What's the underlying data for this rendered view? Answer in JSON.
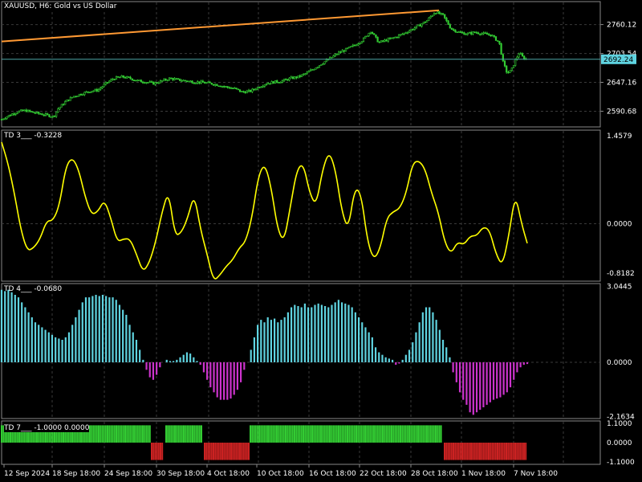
{
  "window": {
    "symbol": "XAUUSD",
    "timeframe": "H6",
    "description": "Gold vs US Dollar",
    "title_text": "XAUUSD, H6:  Gold vs US Dollar"
  },
  "colors": {
    "background": "#000000",
    "grid": "#3a3a3a",
    "candle": "#33cc33",
    "trendline": "#ff9933",
    "price_line": "#4da6a6",
    "price_tag": "#5fd3e0",
    "td3_line": "#ffff00",
    "td4_pos": "#5fd3e0",
    "td4_neg": "#cc33cc",
    "td7_pos": "#33cc33",
    "td7_neg": "#cc2222"
  },
  "time_axis": [
    "12 Sep 2024",
    "18 Sep 18:00",
    "24 Sep 18:00",
    "30 Sep 18:00",
    "4 Oct 18:00",
    "10 Oct 18:00",
    "16 Oct 18:00",
    "22 Oct 18:00",
    "28 Oct 18:00",
    "1 Nov 18:00",
    "7 Nov 18:00"
  ],
  "panes": {
    "price": {
      "axis_labels": [
        "2760.12",
        "2703.54",
        "2647.16",
        "2590.68"
      ],
      "current_price": "2692.24"
    },
    "td3": {
      "label": "TD 3___",
      "value": "-0.3228",
      "axis_labels": [
        "1.4579",
        "0.0000",
        "-0.8182"
      ]
    },
    "td4": {
      "label": "TD 4___",
      "value": "-0.0680",
      "axis_labels": [
        "3.0445",
        "0.0000",
        "-2.1634"
      ]
    },
    "td7": {
      "label": "TD 7___",
      "value": "-1.0000 0.0000",
      "axis_labels": [
        "1.1000",
        "0.0000",
        "-1.1000"
      ]
    }
  },
  "chart_data": [
    {
      "type": "candlestick",
      "title": "XAUUSD, H6:  Gold vs US Dollar",
      "x": [
        "12 Sep 2024",
        "18 Sep 18:00",
        "24 Sep 18:00",
        "30 Sep 18:00",
        "4 Oct 18:00",
        "10 Oct 18:00",
        "16 Oct 18:00",
        "22 Oct 18:00",
        "28 Oct 18:00",
        "1 Nov 18:00",
        "7 Nov 18:00"
      ],
      "close_path": [
        [
          0,
          2575
        ],
        [
          10,
          2583
        ],
        [
          20,
          2590
        ],
        [
          30,
          2592
        ],
        [
          40,
          2588
        ],
        [
          50,
          2585
        ],
        [
          60,
          2582
        ],
        [
          65,
          2580
        ],
        [
          70,
          2595
        ],
        [
          80,
          2610
        ],
        [
          90,
          2620
        ],
        [
          100,
          2625
        ],
        [
          110,
          2630
        ],
        [
          120,
          2632
        ],
        [
          130,
          2645
        ],
        [
          140,
          2655
        ],
        [
          150,
          2658
        ],
        [
          160,
          2655
        ],
        [
          170,
          2650
        ],
        [
          180,
          2648
        ],
        [
          190,
          2645
        ],
        [
          200,
          2650
        ],
        [
          210,
          2655
        ],
        [
          220,
          2652
        ],
        [
          230,
          2650
        ],
        [
          240,
          2648
        ],
        [
          250,
          2647
        ],
        [
          260,
          2645
        ],
        [
          270,
          2642
        ],
        [
          280,
          2638
        ],
        [
          290,
          2635
        ],
        [
          300,
          2628
        ],
        [
          310,
          2630
        ],
        [
          320,
          2638
        ],
        [
          330,
          2645
        ],
        [
          340,
          2648
        ],
        [
          350,
          2650
        ],
        [
          360,
          2655
        ],
        [
          370,
          2658
        ],
        [
          380,
          2665
        ],
        [
          390,
          2675
        ],
        [
          400,
          2685
        ],
        [
          410,
          2695
        ],
        [
          420,
          2705
        ],
        [
          430,
          2712
        ],
        [
          440,
          2720
        ],
        [
          450,
          2730
        ],
        [
          460,
          2748
        ],
        [
          470,
          2725
        ],
        [
          480,
          2730
        ],
        [
          490,
          2735
        ],
        [
          500,
          2742
        ],
        [
          510,
          2750
        ],
        [
          520,
          2758
        ],
        [
          530,
          2768
        ],
        [
          540,
          2785
        ],
        [
          550,
          2778
        ],
        [
          560,
          2752
        ],
        [
          570,
          2745
        ],
        [
          580,
          2742
        ],
        [
          590,
          2745
        ],
        [
          600,
          2742
        ],
        [
          610,
          2740
        ],
        [
          620,
          2725
        ],
        [
          625,
          2685
        ],
        [
          630,
          2665
        ],
        [
          635,
          2670
        ],
        [
          640,
          2690
        ],
        [
          645,
          2705
        ],
        [
          650,
          2695
        ],
        [
          655,
          2692
        ]
      ],
      "trendline": [
        [
          0,
          2727
        ],
        [
          545,
          2788
        ]
      ],
      "y_ticks": [
        2760.12,
        2703.54,
        2647.16,
        2590.68
      ],
      "current_price": 2692.24
    },
    {
      "type": "line",
      "title": "TD 3___ -0.3228",
      "series": [
        {
          "values_path": [
            [
              0,
              1.35
            ],
            [
              8,
              1.0
            ],
            [
              16,
              0.5
            ],
            [
              24,
              -0.1
            ],
            [
              32,
              -0.45
            ],
            [
              40,
              -0.4
            ],
            [
              48,
              -0.25
            ],
            [
              56,
              0.05
            ],
            [
              64,
              0.05
            ],
            [
              72,
              0.3
            ],
            [
              80,
              0.95
            ],
            [
              88,
              1.1
            ],
            [
              96,
              0.9
            ],
            [
              104,
              0.45
            ],
            [
              112,
              0.15
            ],
            [
              120,
              0.2
            ],
            [
              128,
              0.4
            ],
            [
              136,
              0.1
            ],
            [
              144,
              -0.3
            ],
            [
              152,
              -0.25
            ],
            [
              160,
              -0.25
            ],
            [
              168,
              -0.5
            ],
            [
              176,
              -0.8
            ],
            [
              184,
              -0.65
            ],
            [
              192,
              -0.3
            ],
            [
              200,
              0.2
            ],
            [
              208,
              0.55
            ],
            [
              216,
              -0.2
            ],
            [
              224,
              -0.15
            ],
            [
              232,
              0.1
            ],
            [
              240,
              0.5
            ],
            [
              248,
              -0.1
            ],
            [
              256,
              -0.5
            ],
            [
              264,
              -0.95
            ],
            [
              272,
              -0.85
            ],
            [
              280,
              -0.7
            ],
            [
              288,
              -0.6
            ],
            [
              296,
              -0.4
            ],
            [
              304,
              -0.3
            ],
            [
              312,
              0.1
            ],
            [
              320,
              0.8
            ],
            [
              328,
              1.0
            ],
            [
              336,
              0.6
            ],
            [
              344,
              -0.1
            ],
            [
              352,
              -0.3
            ],
            [
              360,
              0.3
            ],
            [
              368,
              0.9
            ],
            [
              376,
              1.0
            ],
            [
              384,
              0.5
            ],
            [
              392,
              0.3
            ],
            [
              400,
              0.9
            ],
            [
              408,
              1.2
            ],
            [
              416,
              0.9
            ],
            [
              424,
              0.2
            ],
            [
              432,
              -0.1
            ],
            [
              440,
              0.6
            ],
            [
              448,
              0.5
            ],
            [
              456,
              -0.3
            ],
            [
              464,
              -0.6
            ],
            [
              472,
              -0.4
            ],
            [
              480,
              0.1
            ],
            [
              488,
              0.2
            ],
            [
              496,
              0.25
            ],
            [
              504,
              0.5
            ],
            [
              512,
              1.0
            ],
            [
              520,
              1.05
            ],
            [
              528,
              0.9
            ],
            [
              536,
              0.5
            ],
            [
              544,
              0.2
            ],
            [
              552,
              -0.3
            ],
            [
              560,
              -0.5
            ],
            [
              568,
              -0.3
            ],
            [
              576,
              -0.35
            ],
            [
              584,
              -0.2
            ],
            [
              592,
              -0.2
            ],
            [
              600,
              -0.05
            ],
            [
              608,
              -0.1
            ],
            [
              616,
              -0.5
            ],
            [
              624,
              -0.7
            ],
            [
              632,
              -0.2
            ],
            [
              640,
              0.5
            ],
            [
              648,
              0.0
            ],
            [
              655,
              -0.3228
            ]
          ]
        }
      ],
      "y_ticks": [
        1.4579,
        0.0,
        -0.8182
      ]
    },
    {
      "type": "bar",
      "title": "TD 4___ -0.0680",
      "values": [
        2.9,
        2.85,
        2.9,
        2.8,
        2.7,
        2.6,
        2.4,
        2.2,
        2.0,
        1.8,
        1.6,
        1.5,
        1.4,
        1.3,
        1.2,
        1.1,
        1.0,
        0.95,
        0.9,
        1.0,
        1.2,
        1.5,
        1.8,
        2.1,
        2.4,
        2.6,
        2.6,
        2.65,
        2.7,
        2.65,
        2.7,
        2.65,
        2.6,
        2.6,
        2.5,
        2.3,
        2.1,
        1.9,
        1.5,
        1.2,
        0.9,
        0.5,
        0.1,
        -0.3,
        -0.6,
        -0.7,
        -0.5,
        -0.2,
        0.0,
        0.1,
        0.05,
        0.05,
        0.1,
        0.2,
        0.3,
        0.4,
        0.35,
        0.2,
        0.05,
        -0.1,
        -0.4,
        -0.7,
        -1.0,
        -1.2,
        -1.4,
        -1.5,
        -1.5,
        -1.5,
        -1.45,
        -1.3,
        -1.1,
        -0.8,
        -0.3,
        0.0,
        0.5,
        1.0,
        1.5,
        1.7,
        1.6,
        1.8,
        1.7,
        1.75,
        1.6,
        1.7,
        1.8,
        2.0,
        2.2,
        2.3,
        2.25,
        2.2,
        2.35,
        2.2,
        2.2,
        2.3,
        2.35,
        2.3,
        2.25,
        2.2,
        2.3,
        2.4,
        2.5,
        2.4,
        2.35,
        2.3,
        2.2,
        2.0,
        1.8,
        1.6,
        1.4,
        1.2,
        1.0,
        0.6,
        0.4,
        0.3,
        0.2,
        0.15,
        0.1,
        -0.1,
        -0.05,
        0.1,
        0.3,
        0.5,
        0.8,
        1.2,
        1.6,
        2.0,
        2.2,
        2.2,
        2.0,
        1.7,
        1.3,
        0.9,
        0.6,
        0.2,
        -0.4,
        -0.8,
        -1.2,
        -1.5,
        -1.7,
        -2.0,
        -2.1,
        -2.0,
        -1.9,
        -1.8,
        -1.7,
        -1.6,
        -1.5,
        -1.45,
        -1.4,
        -1.3,
        -1.2,
        -1.0,
        -0.7,
        -0.4,
        -0.2,
        -0.1,
        -0.068
      ],
      "y_ticks": [
        3.0445,
        0.0,
        -2.1634
      ]
    },
    {
      "type": "bar",
      "title": "TD 7___ -1.0000 0.0000",
      "segments": [
        {
          "from": 0,
          "to": 185,
          "value": 1
        },
        {
          "from": 187,
          "to": 202,
          "value": -1
        },
        {
          "from": 205,
          "to": 250,
          "value": 1
        },
        {
          "from": 253,
          "to": 308,
          "value": -1
        },
        {
          "from": 310,
          "to": 549,
          "value": 1
        },
        {
          "from": 552,
          "to": 655,
          "value": -1
        }
      ],
      "y_ticks": [
        1.1,
        0.0,
        -1.1
      ]
    }
  ]
}
